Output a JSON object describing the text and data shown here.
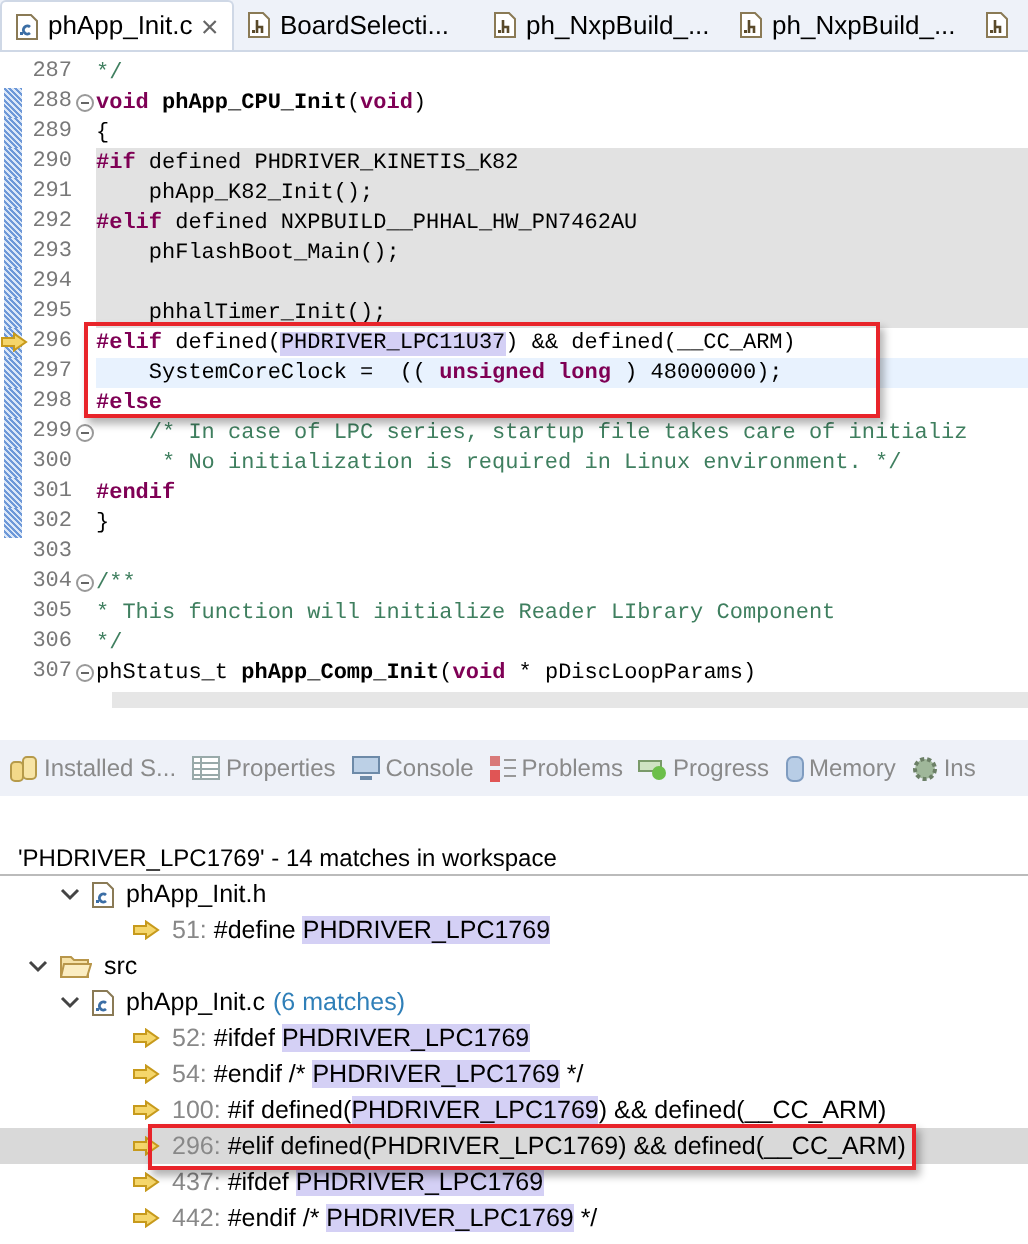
{
  "editor_tabs": [
    {
      "label": "phApp_Init.c",
      "kind": "c-file",
      "selected": true,
      "closable": true
    },
    {
      "label": "BoardSelecti...",
      "kind": "h-file",
      "selected": false
    },
    {
      "label": "ph_NxpBuild_...",
      "kind": "h-file",
      "selected": false
    },
    {
      "label": "ph_NxpBuild_...",
      "kind": "h-file",
      "selected": false
    },
    {
      "kind": "h-file",
      "selected": false
    }
  ],
  "code_lines": [
    {
      "number": "287",
      "segments": [
        {
          "kind": "comment",
          "text": "*/"
        }
      ]
    },
    {
      "number": "288",
      "changed": true,
      "foldable": true,
      "segments": [
        {
          "kind": "keyword",
          "text": "void"
        },
        {
          "kind": "bold",
          "text": " phApp_CPU_Init"
        },
        {
          "kind": "text",
          "text": "("
        },
        {
          "kind": "keyword",
          "text": "void"
        },
        {
          "kind": "text",
          "text": ")"
        }
      ]
    },
    {
      "number": "289",
      "changed": true,
      "segments": [
        {
          "kind": "text",
          "text": "{"
        }
      ]
    },
    {
      "number": "290",
      "changed": true,
      "inactive": true,
      "segments": [
        {
          "kind": "keyword",
          "text": "#if"
        },
        {
          "kind": "text",
          "text": " defined PHDRIVER_KINETIS_K82"
        }
      ]
    },
    {
      "number": "291",
      "changed": true,
      "inactive": true,
      "segments": [
        {
          "kind": "text",
          "text": "    phApp_K82_Init();"
        }
      ]
    },
    {
      "number": "292",
      "changed": true,
      "inactive": true,
      "segments": [
        {
          "kind": "keyword",
          "text": "#elif"
        },
        {
          "kind": "text",
          "text": " defined NXPBUILD__PHHAL_HW_PN7462AU"
        }
      ]
    },
    {
      "number": "293",
      "changed": true,
      "inactive": true,
      "segments": [
        {
          "kind": "text",
          "text": "    phFlashBoot_Main();"
        }
      ]
    },
    {
      "number": "294",
      "changed": true,
      "inactive": true
    },
    {
      "number": "295",
      "changed": true,
      "inactive": true,
      "segments": [
        {
          "kind": "text",
          "text": "    phhalTimer_Init();"
        }
      ]
    },
    {
      "number": "296",
      "changed": true,
      "marker": true,
      "boxed": true,
      "segments": [
        {
          "kind": "keyword",
          "text": "#elif"
        },
        {
          "kind": "text",
          "text": " defined("
        },
        {
          "kind": "match",
          "text": "PHDRIVER_LPC11U37"
        },
        {
          "kind": "text",
          "text": ") && defined(__CC_ARM)"
        }
      ]
    },
    {
      "number": "297",
      "changed": true,
      "current": true,
      "boxed": true,
      "segments": [
        {
          "kind": "text",
          "text": "    SystemCoreClock =  (( "
        },
        {
          "kind": "keyword",
          "text": "unsigned long"
        },
        {
          "kind": "text",
          "text": " ) 48000000);"
        }
      ]
    },
    {
      "number": "298",
      "changed": true,
      "boxed": true,
      "segments": [
        {
          "kind": "keyword",
          "text": "#else"
        }
      ]
    },
    {
      "number": "299",
      "changed": true,
      "foldable": true,
      "segments": [
        {
          "kind": "comment",
          "text": "    /* In case of LPC series, startup file takes care of initializ"
        }
      ]
    },
    {
      "number": "300",
      "changed": true,
      "segments": [
        {
          "kind": "comment",
          "text": "     * No initialization is required in Linux environment. */"
        }
      ]
    },
    {
      "number": "301",
      "changed": true,
      "segments": [
        {
          "kind": "keyword",
          "text": "#endif"
        }
      ]
    },
    {
      "number": "302",
      "changed": true,
      "segments": [
        {
          "kind": "text",
          "text": "}"
        }
      ]
    },
    {
      "number": "303"
    },
    {
      "number": "304",
      "foldable": true,
      "segments": [
        {
          "kind": "comment",
          "text": "/**"
        }
      ]
    },
    {
      "number": "305",
      "segments": [
        {
          "kind": "comment",
          "text": "* This function will initialize Reader LIbrary Component"
        }
      ]
    },
    {
      "number": "306",
      "segments": [
        {
          "kind": "comment",
          "text": "*/"
        }
      ]
    },
    {
      "number": "307",
      "foldable": true,
      "segments": [
        {
          "kind": "text",
          "text": "phStatus_t "
        },
        {
          "kind": "bold",
          "text": "phApp_Comp_Init"
        },
        {
          "kind": "text",
          "text": "("
        },
        {
          "kind": "keyword",
          "text": "void"
        },
        {
          "kind": "text",
          "text": " * pDiscLoopParams)"
        }
      ]
    }
  ],
  "view_tabs": [
    {
      "label": "Installed S..."
    },
    {
      "label": "Properties"
    },
    {
      "label": "Console"
    },
    {
      "label": "Problems"
    },
    {
      "label": "Progress"
    },
    {
      "label": "Memory"
    },
    {
      "label": "Ins"
    }
  ],
  "search": {
    "summary": "'PHDRIVER_LPC1769' - 14 matches in workspace",
    "tree": [
      {
        "kind": "parent",
        "children": [
          {
            "kind": "file",
            "label": "phApp_Init.h",
            "expanded": true,
            "children": [
              {
                "kind": "match",
                "line": "51:",
                "selected": false,
                "segments": [
                  {
                    "kind": "text",
                    "text": "#define "
                  },
                  {
                    "kind": "match",
                    "text": "PHDRIVER_LPC1769"
                  }
                ]
              }
            ]
          }
        ]
      },
      {
        "kind": "folder",
        "label": "src",
        "expanded": true,
        "children": [
          {
            "kind": "file",
            "label": "phApp_Init.c",
            "count": "(6 matches)",
            "expanded": true,
            "children": [
              {
                "kind": "match",
                "line": "52:",
                "selected": false,
                "segments": [
                  {
                    "kind": "text",
                    "text": "#ifdef "
                  },
                  {
                    "kind": "match",
                    "text": "PHDRIVER_LPC1769"
                  }
                ]
              },
              {
                "kind": "match",
                "line": "54:",
                "selected": false,
                "segments": [
                  {
                    "kind": "text",
                    "text": "#endif /* "
                  },
                  {
                    "kind": "match",
                    "text": "PHDRIVER_LPC1769"
                  },
                  {
                    "kind": "text",
                    "text": " */"
                  }
                ]
              },
              {
                "kind": "match",
                "line": "100:",
                "selected": false,
                "segments": [
                  {
                    "kind": "text",
                    "text": "#if defined("
                  },
                  {
                    "kind": "match",
                    "text": "PHDRIVER_LPC1769"
                  },
                  {
                    "kind": "text",
                    "text": ") && defined(__CC_ARM)"
                  }
                ]
              },
              {
                "kind": "match",
                "line": "296:",
                "selected": true,
                "boxed": true,
                "segments": [
                  {
                    "kind": "text",
                    "text": "#elif defined("
                  },
                  {
                    "kind": "text",
                    "text": "PHDRIVER_LPC1769"
                  },
                  {
                    "kind": "text",
                    "text": ") && defined(__CC_ARM)"
                  }
                ]
              },
              {
                "kind": "match",
                "line": "437:",
                "selected": false,
                "segments": [
                  {
                    "kind": "text",
                    "text": "#ifdef "
                  },
                  {
                    "kind": "match",
                    "text": "PHDRIVER_LPC1769"
                  }
                ]
              },
              {
                "kind": "match",
                "line": "442:",
                "selected": false,
                "segments": [
                  {
                    "kind": "text",
                    "text": "#endif /* "
                  },
                  {
                    "kind": "match",
                    "text": "PHDRIVER_LPC1769"
                  },
                  {
                    "kind": "text",
                    "text": " */"
                  }
                ]
              }
            ]
          }
        ]
      }
    ]
  }
}
